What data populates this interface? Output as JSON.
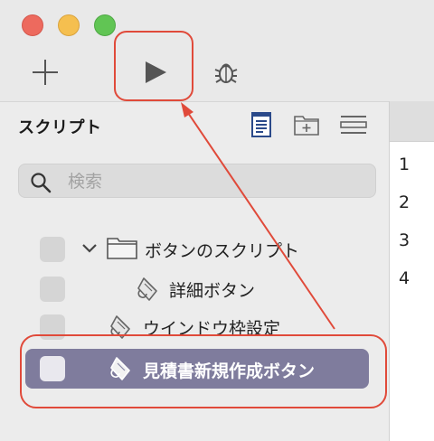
{
  "sidebar": {
    "title": "スクリプト",
    "search_placeholder": "検索",
    "items": [
      {
        "label": "ボタンのスクリプト",
        "type": "folder",
        "expanded": true
      },
      {
        "label": "詳細ボタン",
        "type": "script"
      },
      {
        "label": "ウインドウ枠設定",
        "type": "script"
      },
      {
        "label": "見積書新規作成ボタン",
        "type": "script",
        "selected": true
      }
    ]
  },
  "editor": {
    "line_numbers": [
      "1",
      "2",
      "3",
      "4"
    ]
  },
  "toolbar": {
    "icons": [
      "plus-icon",
      "play-icon",
      "bug-icon"
    ]
  },
  "colors": {
    "selection": "#7f7c9d",
    "annotation": "#e04a3a"
  }
}
